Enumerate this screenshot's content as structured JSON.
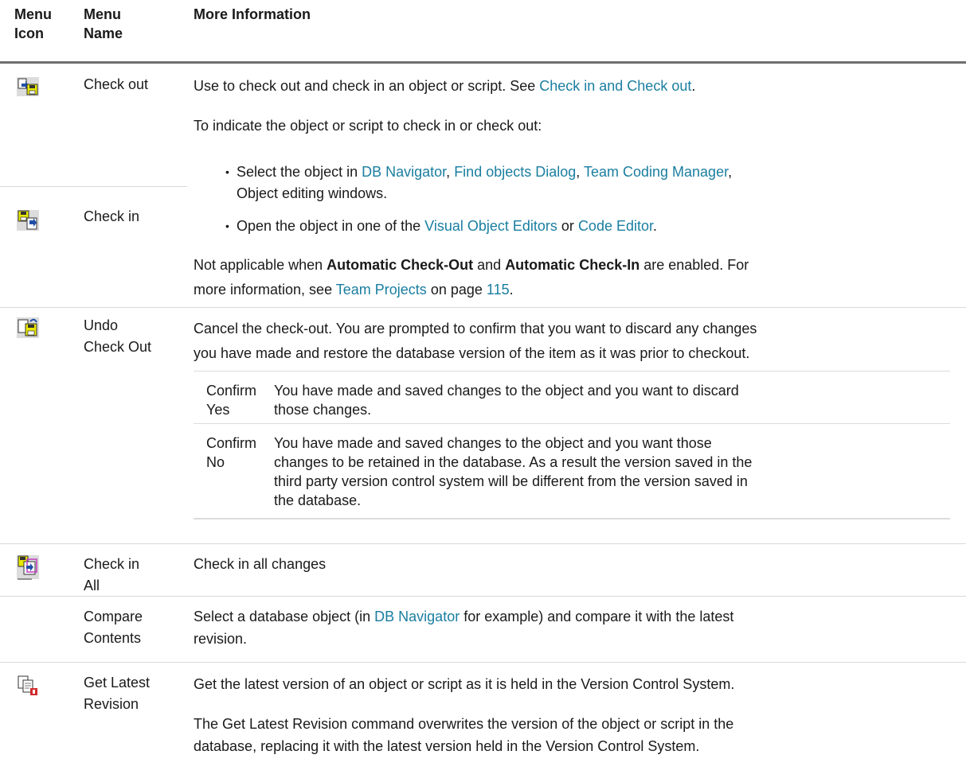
{
  "header": {
    "menu_icon": "Menu\nIcon",
    "menu_name": "Menu\nName",
    "more_info": "More Information"
  },
  "rows": {
    "checkout": {
      "icon": "check-out-icon",
      "name": "Check out",
      "p1_pre": "Use to check out and check in an object or script. See ",
      "p1_link": "Check in and Check out",
      "p1_post": ".",
      "p2": "To indicate the object or script to check in or check out:",
      "b1_pre": "Select the object in ",
      "b1_link1": "DB Navigator",
      "b1_sep1": ", ",
      "b1_link2": "Find objects Dialog",
      "b1_sep2": ", ",
      "b1_link3": "Team Coding Manager",
      "b1_post": ",",
      "b1_line2": "Object editing windows.",
      "b2_pre": "Open the object in one of the ",
      "b2_link1": "Visual Object Editors",
      "b2_sep": " or ",
      "b2_link2": "Code Editor",
      "b2_post": ".",
      "p3_pre": "Not applicable when ",
      "p3_b1": "Automatic Check-Out",
      "p3_mid": " and ",
      "p3_b2": "Automatic Check-In",
      "p3_post": " are enabled. For",
      "p3_line2_pre": "more information, see ",
      "p3_link1": "Team Projects",
      "p3_line2_mid": " on page ",
      "p3_link2": "115",
      "p3_line2_post": "."
    },
    "checkin": {
      "icon": "check-in-icon",
      "name": "Check in"
    },
    "undo": {
      "icon": "undo-check-out-icon",
      "name": "Undo\nCheck Out",
      "p1": "Cancel the check-out. You are prompted to confirm that you want to discard any changes",
      "p1_line2": "you have made and restore the database version of the item as it was prior to checkout.",
      "sub": [
        {
          "label": "Confirm\nYes",
          "text": "You have made and saved changes to the object and you want to discard\nthose changes."
        },
        {
          "label": "Confirm\nNo",
          "text": "You have made and saved changes to the object and you want those\nchanges to be retained in the database. As a result the version saved in the\nthird party version control system will be different from the version saved in\nthe database."
        }
      ]
    },
    "checkinall": {
      "icon": "check-in-all-icon",
      "name": "Check in\nAll",
      "text": "Check in all changes"
    },
    "compare": {
      "name": "Compare\nContents",
      "pre": "Select a database object (in ",
      "link": "DB Navigator",
      "post": " for example) and compare it with the latest",
      "line2": "revision."
    },
    "getlatest": {
      "icon": "get-latest-revision-icon",
      "name": "Get Latest\nRevision",
      "p1": "Get the latest version of an object or script as it is held in the Version Control System.",
      "p2": "The Get Latest Revision command overwrites the version of the object or script in the",
      "p2_line2": "database, replacing it with the latest version held in the Version Control System."
    }
  },
  "colors": {
    "link": "#1a7ea0",
    "text": "#1a1a1a",
    "header_rule": "#6e6e6e",
    "row_rule": "#d9d9d9"
  }
}
